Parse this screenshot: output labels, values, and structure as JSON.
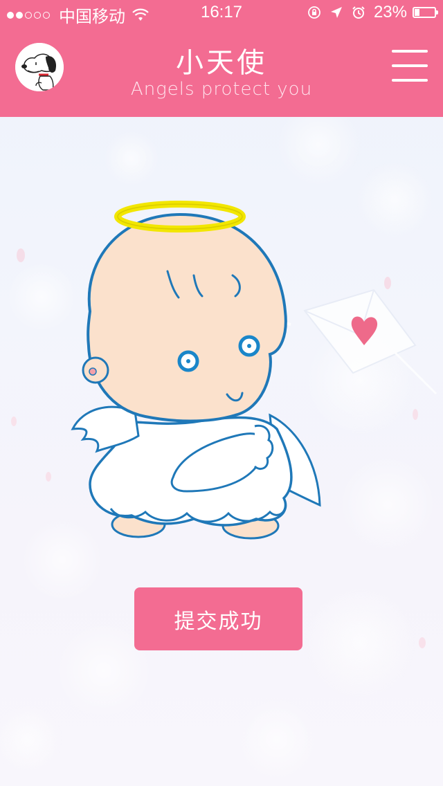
{
  "status_bar": {
    "carrier": "中国移动",
    "time": "16:17",
    "battery_percent": "23%",
    "battery_level": 0.23,
    "signal_bars_filled": 2,
    "signal_bars_total": 5
  },
  "header": {
    "title": "小天使",
    "subtitle": "Angels protect you",
    "avatar_icon": "snoopy-avatar",
    "menu_icon": "hamburger-menu-icon"
  },
  "main": {
    "illustration": "angel-baby-illustration",
    "submit_label": "提交成功"
  },
  "colors": {
    "brand_pink": "#f36c92",
    "outline_blue": "#1f78b8",
    "halo_yellow": "#f2e600",
    "skin": "#fbe1cc",
    "heart": "#ee6a8a"
  }
}
